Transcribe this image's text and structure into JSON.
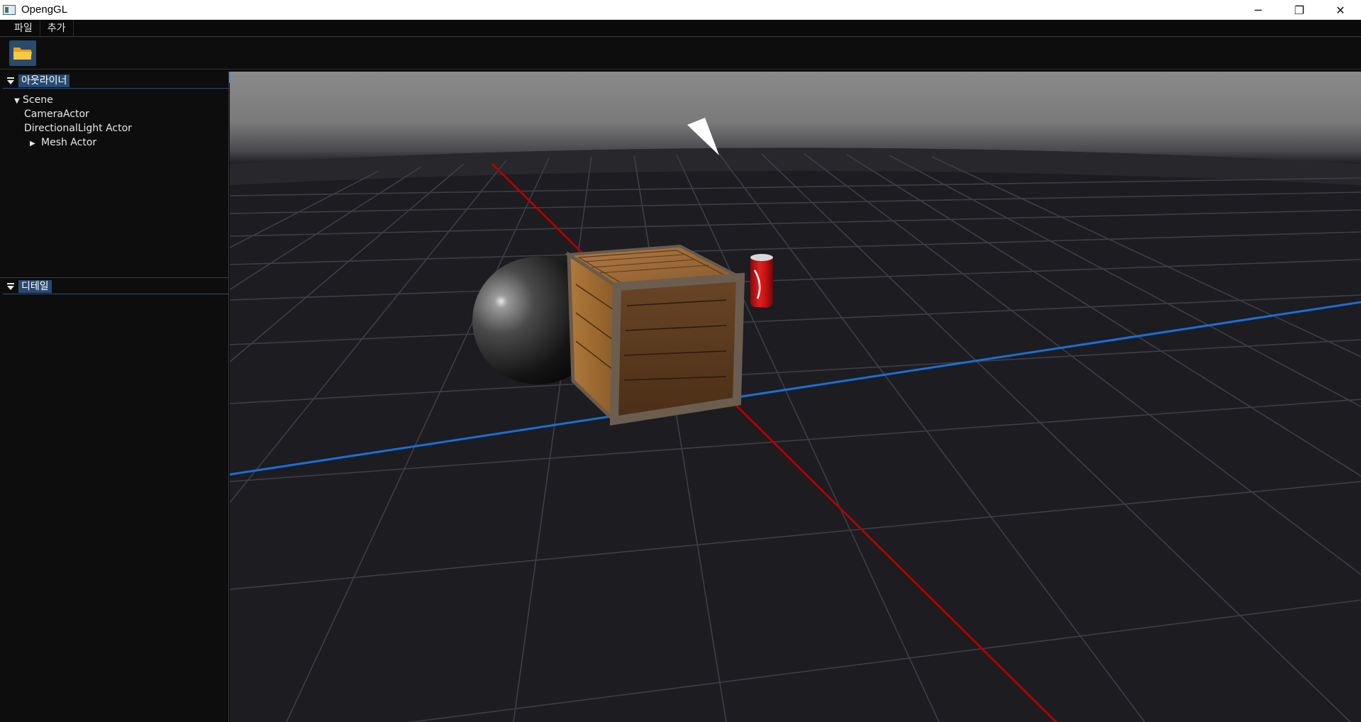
{
  "window": {
    "title": "OpengGL",
    "minimize_glyph": "─",
    "restore_glyph": "❐",
    "close_glyph": "✕"
  },
  "menu": {
    "items": [
      {
        "label": "파일"
      },
      {
        "label": "추가"
      }
    ]
  },
  "toolbar": {
    "open_icon": "folder-icon"
  },
  "outliner": {
    "title": "아웃라이너",
    "tree": [
      {
        "label": "Scene",
        "expanded": true,
        "level": 0
      },
      {
        "label": "CameraActor",
        "level": 1
      },
      {
        "label": "DirectionalLight Actor",
        "level": 1
      },
      {
        "label": "Mesh Actor",
        "expanded": false,
        "level": 1
      }
    ]
  },
  "details": {
    "title": "디테일"
  },
  "colors": {
    "panel_bg": "#0d0d0d",
    "header_highlight": "#284a70",
    "axis_x": "#b00000",
    "axis_z": "#1a6fd6",
    "grid": "#4a4a52"
  }
}
